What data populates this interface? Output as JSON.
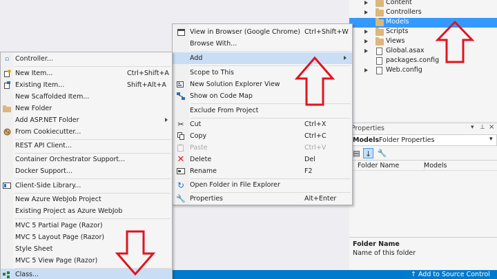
{
  "solution_explorer": {
    "items": [
      {
        "label": "Content",
        "kind": "folder",
        "expandable": true
      },
      {
        "label": "Controllers",
        "kind": "folder",
        "expandable": true
      },
      {
        "label": "Models",
        "kind": "folder",
        "expandable": false,
        "selected": true
      },
      {
        "label": "Scripts",
        "kind": "folder",
        "expandable": true
      },
      {
        "label": "Views",
        "kind": "folder",
        "expandable": true
      },
      {
        "label": "Global.asax",
        "kind": "file",
        "expandable": true
      },
      {
        "label": "packages.config",
        "kind": "file",
        "expandable": false
      },
      {
        "label": "Web.config",
        "kind": "file",
        "expandable": true
      }
    ]
  },
  "properties": {
    "title": "Properties",
    "object_name": "Models",
    "object_type": "Folder Properties",
    "grid": {
      "name": "Folder Name",
      "value": "Models"
    },
    "desc_title": "Folder Name",
    "desc_text": "Name of this folder"
  },
  "context_menu": {
    "items": [
      {
        "label": "View in Browser (Google Chrome)",
        "shortcut": "Ctrl+Shift+W",
        "icon": "browser-icon"
      },
      {
        "label": "Browse With...",
        "shortcut": "",
        "icon": ""
      },
      {
        "label": "Add",
        "shortcut": "",
        "icon": "",
        "submenu": true,
        "highlighted": true
      },
      {
        "label": "Scope to This",
        "shortcut": "",
        "icon": ""
      },
      {
        "label": "New Solution Explorer View",
        "shortcut": "",
        "icon": "new-view-icon"
      },
      {
        "label": "Show on Code Map",
        "shortcut": "",
        "icon": "code-map-icon"
      },
      {
        "label": "Exclude From Project",
        "shortcut": "",
        "icon": ""
      },
      {
        "label": "Cut",
        "shortcut": "Ctrl+X",
        "icon": "scissors-icon"
      },
      {
        "label": "Copy",
        "shortcut": "Ctrl+C",
        "icon": "copy-icon"
      },
      {
        "label": "Paste",
        "shortcut": "Ctrl+V",
        "icon": "paste-icon",
        "disabled": true
      },
      {
        "label": "Delete",
        "shortcut": "Del",
        "icon": "delete-icon"
      },
      {
        "label": "Rename",
        "shortcut": "F2",
        "icon": "rename-icon"
      },
      {
        "label": "Open Folder in File Explorer",
        "shortcut": "",
        "icon": "refresh-icon"
      },
      {
        "label": "Properties",
        "shortcut": "Alt+Enter",
        "icon": "wrench-icon"
      }
    ]
  },
  "add_menu": {
    "items": [
      {
        "label": "Controller...",
        "shortcut": "",
        "icon": "controller-icon"
      },
      {
        "label": "New Item...",
        "shortcut": "Ctrl+Shift+A",
        "icon": "new-item-icon"
      },
      {
        "label": "Existing Item...",
        "shortcut": "Shift+Alt+A",
        "icon": "existing-item-icon"
      },
      {
        "label": "New Scaffolded Item...",
        "shortcut": "",
        "icon": ""
      },
      {
        "label": "New Folder",
        "shortcut": "",
        "icon": "folder-icon"
      },
      {
        "label": "Add ASP.NET Folder",
        "shortcut": "",
        "icon": "",
        "submenu": true
      },
      {
        "label": "From Cookiecutter...",
        "shortcut": "",
        "icon": "cookiecutter-icon"
      },
      {
        "label": "REST API Client...",
        "shortcut": "",
        "icon": ""
      },
      {
        "label": "Container Orchestrator Support...",
        "shortcut": "",
        "icon": ""
      },
      {
        "label": "Docker Support...",
        "shortcut": "",
        "icon": ""
      },
      {
        "label": "Client-Side Library...",
        "shortcut": "",
        "icon": "library-icon"
      },
      {
        "label": "New Azure WebJob Project",
        "shortcut": "",
        "icon": ""
      },
      {
        "label": "Existing Project as Azure WebJob",
        "shortcut": "",
        "icon": ""
      },
      {
        "label": "MVC 5 Partial Page (Razor)",
        "shortcut": "",
        "icon": ""
      },
      {
        "label": "MVC 5 Layout Page (Razor)",
        "shortcut": "",
        "icon": ""
      },
      {
        "label": "Style Sheet",
        "shortcut": "",
        "icon": ""
      },
      {
        "label": "MVC 5 View Page (Razor)",
        "shortcut": "",
        "icon": ""
      },
      {
        "label": "Class...",
        "shortcut": "",
        "icon": "class-icon",
        "highlighted": true
      }
    ]
  },
  "status_bar": {
    "source_control": "↑ Add to Source Control"
  },
  "colors": {
    "accent": "#007acc",
    "selection": "#3399ff",
    "highlight": "#c9def5",
    "arrow": "#e0141e"
  }
}
